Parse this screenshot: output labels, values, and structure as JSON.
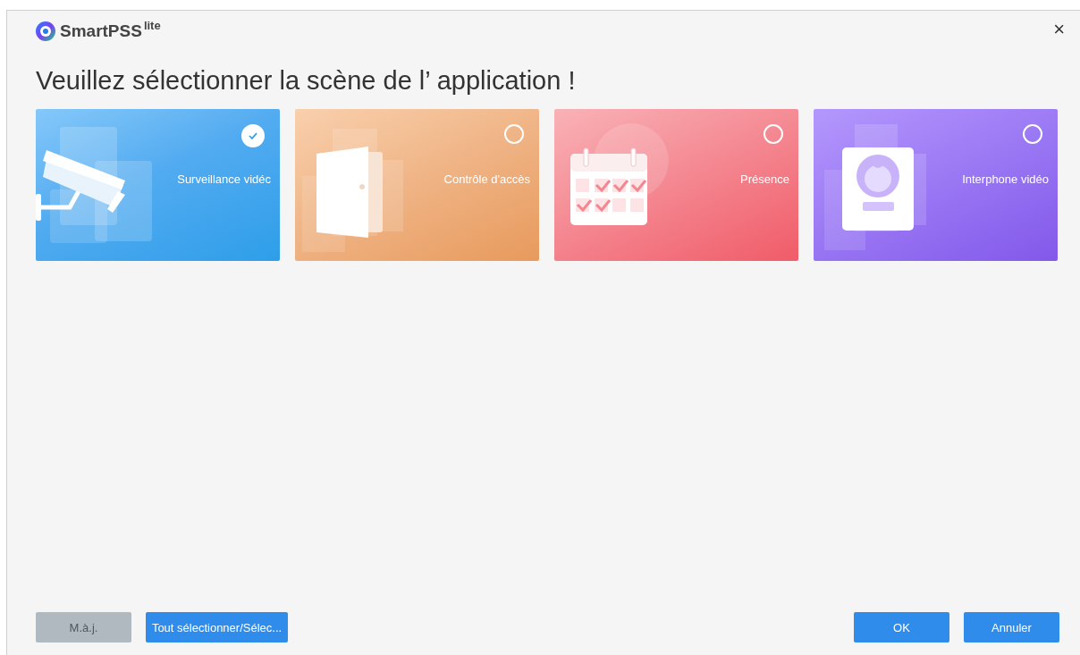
{
  "window": {
    "logo": "SmartPSS",
    "logo_sup": "lite",
    "close": "×"
  },
  "heading": "Veuillez sélectionner la scène de l’  application !",
  "scenes": [
    {
      "kind": "camera",
      "label": "Surveillance vidéc",
      "selected": true
    },
    {
      "kind": "door",
      "label": "Contrôle d'accès",
      "selected": false
    },
    {
      "kind": "calendar",
      "label": "Présence",
      "selected": false
    },
    {
      "kind": "intercom",
      "label": "Interphone vidéo",
      "selected": false
    }
  ],
  "left_buttons": [
    {
      "label": "M.à.j.",
      "disabled": true
    },
    {
      "label": "Tout sélectionner/Sélec...",
      "disabled": false
    }
  ],
  "right_buttons": [
    {
      "label": "OK",
      "disabled": false
    },
    {
      "label": "Annuler",
      "disabled": false
    }
  ]
}
